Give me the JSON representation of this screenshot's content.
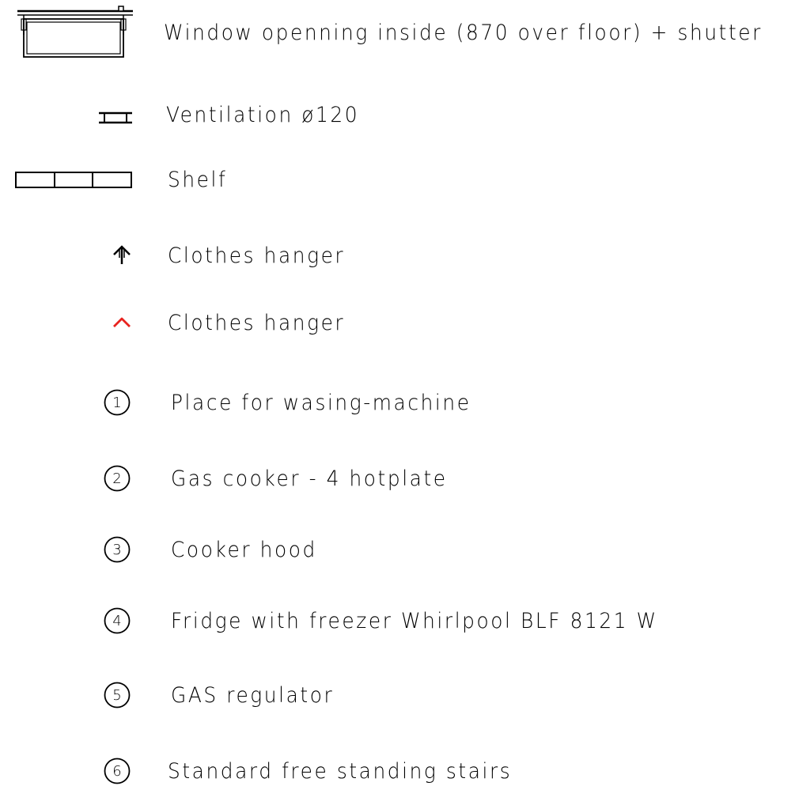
{
  "legend": {
    "items": [
      {
        "symbol": "window-shutter-icon",
        "label": "Window openning inside (870 over floor) + shutter"
      },
      {
        "symbol": "ventilation-icon",
        "label": "Ventilation ø120"
      },
      {
        "symbol": "shelf-icon",
        "label": "Shelf"
      },
      {
        "symbol": "clothes-hanger-arrow-icon",
        "label": "Clothes hanger"
      },
      {
        "symbol": "clothes-hanger-red-icon",
        "label": "Clothes hanger",
        "color": "#e8231f"
      },
      {
        "symbol": "numbered-circle",
        "number": "1",
        "label": "Place for wasing-machine"
      },
      {
        "symbol": "numbered-circle",
        "number": "2",
        "label": "Gas cooker - 4 hotplate"
      },
      {
        "symbol": "numbered-circle",
        "number": "3",
        "label": "Cooker hood"
      },
      {
        "symbol": "numbered-circle",
        "number": "4",
        "label": "Fridge with freezer Whirlpool BLF 8121 W"
      },
      {
        "symbol": "numbered-circle",
        "number": "5",
        "label": "GAS regulator"
      },
      {
        "symbol": "numbered-circle",
        "number": "6",
        "label": "Standard free standing stairs"
      }
    ]
  }
}
